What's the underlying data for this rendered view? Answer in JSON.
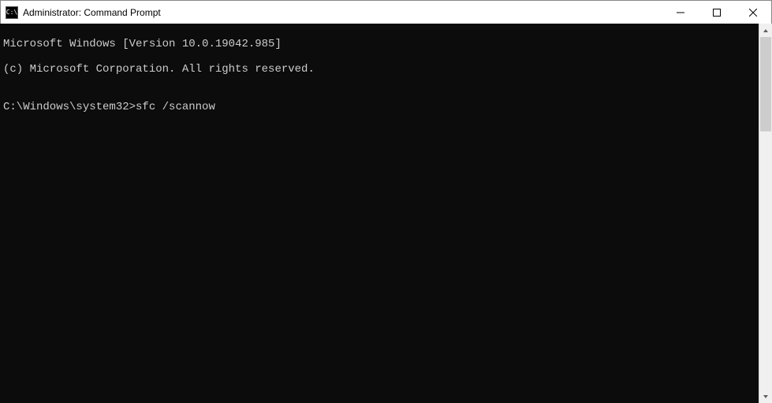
{
  "window": {
    "title": "Administrator: Command Prompt",
    "icon_label": "C:\\"
  },
  "console": {
    "line1": "Microsoft Windows [Version 10.0.19042.985]",
    "line2": "(c) Microsoft Corporation. All rights reserved.",
    "blank": "",
    "prompt": "C:\\Windows\\system32>",
    "command": "sfc /scannow"
  }
}
